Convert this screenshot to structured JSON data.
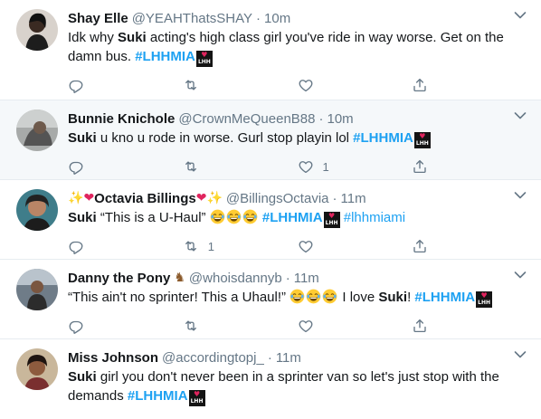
{
  "tweets": [
    {
      "name": "Shay Elle",
      "handle": "@YEAHThatsSHAY",
      "time": "10m",
      "text_pre": "Idk why ",
      "text_bold": "Suki",
      "text_post": " acting's high class girl you've ride in way worse. Get on the damn bus. ",
      "hashtag": "#LHHMIA",
      "reply_count": "",
      "retweet_count": "",
      "like_count": ""
    },
    {
      "name": "Bunnie Knichole",
      "handle": "@CrownMeQueenB88",
      "time": "10m",
      "text_bold": "Suki",
      "text_post": " u kno u rode in worse. Gurl stop playin lol ",
      "hashtag": "#LHHMIA",
      "reply_count": "",
      "retweet_count": "",
      "like_count": "1"
    },
    {
      "name": "Octavia Billings",
      "handle": "@BillingsOctavia",
      "time": "11m",
      "text_bold": "Suki",
      "text_post": " “This is a U-Haul” ",
      "hashtag": "#LHHMIA",
      "hashtag2": "#lhhmiami",
      "reply_count": "",
      "retweet_count": "1",
      "like_count": ""
    },
    {
      "name": "Danny the Pony",
      "handle": "@whoisdannyb",
      "time": "11m",
      "text_pre": "“This ain't no sprinter! This a Uhaul!” ",
      "text_mid": " I love ",
      "text_bold": "Suki",
      "text_post": "! ",
      "hashtag": "#LHHMIA",
      "reply_count": "",
      "retweet_count": "",
      "like_count": ""
    },
    {
      "name": "Miss Johnson",
      "handle": "@accordingtopj_",
      "time": "11m",
      "text_bold": "Suki",
      "text_post": " girl you don't never been in a sprinter van so let's just stop with the demands  ",
      "hashtag": "#LHHMIA"
    }
  ],
  "separator": "·",
  "colors": {
    "link": "#1da1f2",
    "muted": "#657786",
    "highlight_bg": "#f5f8fa",
    "border": "#e6ecf0"
  },
  "icons": [
    "reply-icon",
    "retweet-icon",
    "like-icon",
    "share-icon",
    "chevron-down-icon",
    "lhh-badge-icon",
    "laughing-emoji-icon"
  ]
}
